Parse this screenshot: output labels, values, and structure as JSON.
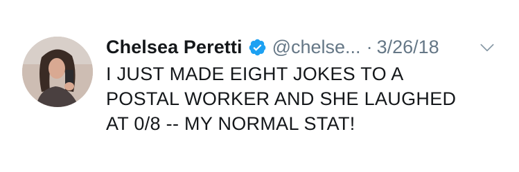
{
  "tweet": {
    "author": {
      "name": "Chelsea Peretti",
      "handle": "@chelse...",
      "verified": true
    },
    "separator": "·",
    "date": "3/26/18",
    "text_lines": [
      "I JUST MADE EIGHT JOKES TO A",
      "POSTAL WORKER AND SHE LAUGHED",
      "AT 0/8 -- MY NORMAL STAT!"
    ]
  },
  "icons": {
    "verified": "verified-badge-icon",
    "menu": "chevron-down-icon"
  },
  "colors": {
    "verified": "#1da1f2",
    "secondary_text": "#657786",
    "primary_text": "#14171a"
  }
}
